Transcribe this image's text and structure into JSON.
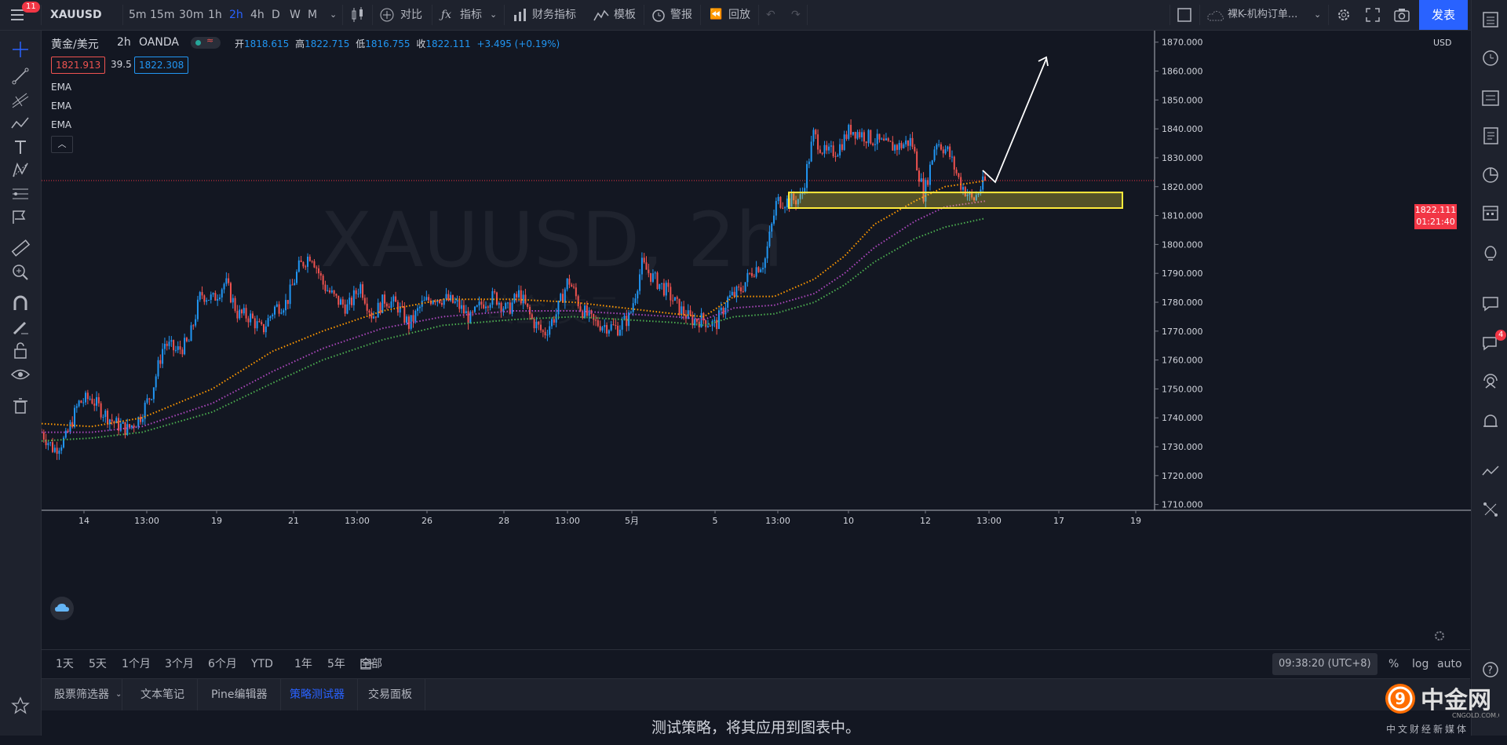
{
  "topbar": {
    "menu_badge": "11",
    "symbol": "XAUUSD",
    "intervals": [
      "5m",
      "15m",
      "30m",
      "1h",
      "2h",
      "4h",
      "D",
      "W",
      "M"
    ],
    "active_interval": "2h",
    "compare": "对比",
    "indicators": "指标",
    "financials": "财务指标",
    "templates": "模板",
    "alert": "警报",
    "replay": "回放",
    "layout_name": "裸K-机构订单...",
    "publish": "发表"
  },
  "legend": {
    "title": "黄金/美元",
    "interval": "2h",
    "source": "OANDA",
    "open_label": "开",
    "open": "1818.615",
    "high_label": "高",
    "high": "1822.715",
    "low_label": "低",
    "low": "1816.755",
    "close_label": "收",
    "close": "1822.111",
    "change": "+3.495 (+0.19%)",
    "bid": "1821.913",
    "spread": "39.5",
    "ask": "1822.308",
    "indicators": [
      "EMA",
      "EMA",
      "EMA"
    ]
  },
  "watermark": {
    "symbol": "XAUUSD, 2h",
    "name": "黄金/美元"
  },
  "price_axis": {
    "currency": "USD",
    "current_price": "1822.111",
    "countdown": "01:21:40"
  },
  "chart_data": {
    "type": "candlestick",
    "y_ticks": [
      "1870.000",
      "1860.000",
      "1850.000",
      "1840.000",
      "1830.000",
      "1820.000",
      "1810.000",
      "1800.000",
      "1790.000",
      "1780.000",
      "1770.000",
      "1760.000",
      "1750.000",
      "1740.000",
      "1730.000",
      "1720.000",
      "1710.000"
    ],
    "x_ticks": [
      "14",
      "13:00",
      "19",
      "21",
      "13:00",
      "26",
      "28",
      "13:00",
      "5月",
      "5",
      "13:00",
      "10",
      "12",
      "13:00",
      "17",
      "19"
    ],
    "ylim": [
      1708,
      1874
    ],
    "current_price": 1822.111,
    "close_path": [
      1735,
      1729,
      1733,
      1745,
      1747,
      1742,
      1738,
      1736,
      1740,
      1749,
      1766,
      1763,
      1766,
      1783,
      1781,
      1787,
      1776,
      1775,
      1770,
      1778,
      1780,
      1792,
      1797,
      1786,
      1781,
      1778,
      1786,
      1775,
      1781,
      1779,
      1772,
      1779,
      1782,
      1781,
      1779,
      1774,
      1780,
      1782,
      1777,
      1783,
      1774,
      1769,
      1776,
      1788,
      1778,
      1773,
      1772,
      1771,
      1775,
      1793,
      1788,
      1784,
      1778,
      1774,
      1774,
      1772,
      1781,
      1784,
      1791,
      1794,
      1815,
      1815,
      1816,
      1838,
      1831,
      1833,
      1840,
      1838,
      1836,
      1834,
      1834,
      1836,
      1817,
      1836,
      1832,
      1821,
      1815,
      1822.1
    ],
    "ema_fast": {
      "color": "#ff9800",
      "values": [
        [
          0,
          1738
        ],
        [
          0.05,
          1737
        ],
        [
          0.1,
          1740
        ],
        [
          0.17,
          1750
        ],
        [
          0.23,
          1763
        ],
        [
          0.28,
          1770
        ],
        [
          0.34,
          1777
        ],
        [
          0.4,
          1781
        ],
        [
          0.47,
          1781
        ],
        [
          0.53,
          1780
        ],
        [
          0.58,
          1778
        ],
        [
          0.63,
          1776
        ],
        [
          0.66,
          1775
        ],
        [
          0.69,
          1782
        ],
        [
          0.73,
          1782
        ],
        [
          0.77,
          1788
        ],
        [
          0.8,
          1796
        ],
        [
          0.83,
          1807
        ],
        [
          0.87,
          1815
        ],
        [
          0.9,
          1820
        ],
        [
          0.94,
          1822
        ]
      ]
    },
    "ema_mid": {
      "color": "#ab47bc",
      "values": [
        [
          0,
          1735
        ],
        [
          0.05,
          1735
        ],
        [
          0.1,
          1737
        ],
        [
          0.17,
          1745
        ],
        [
          0.23,
          1756
        ],
        [
          0.28,
          1764
        ],
        [
          0.34,
          1771
        ],
        [
          0.4,
          1775
        ],
        [
          0.47,
          1777
        ],
        [
          0.53,
          1777
        ],
        [
          0.58,
          1776
        ],
        [
          0.63,
          1775
        ],
        [
          0.66,
          1774
        ],
        [
          0.69,
          1778
        ],
        [
          0.73,
          1779
        ],
        [
          0.77,
          1783
        ],
        [
          0.8,
          1790
        ],
        [
          0.83,
          1799
        ],
        [
          0.87,
          1808
        ],
        [
          0.9,
          1813
        ],
        [
          0.94,
          1815
        ]
      ]
    },
    "ema_slow": {
      "color": "#4caf50",
      "values": [
        [
          0,
          1732
        ],
        [
          0.05,
          1733
        ],
        [
          0.1,
          1735
        ],
        [
          0.17,
          1742
        ],
        [
          0.23,
          1752
        ],
        [
          0.28,
          1760
        ],
        [
          0.34,
          1767
        ],
        [
          0.4,
          1772
        ],
        [
          0.47,
          1774
        ],
        [
          0.53,
          1775
        ],
        [
          0.58,
          1774
        ],
        [
          0.63,
          1773
        ],
        [
          0.66,
          1772
        ],
        [
          0.69,
          1775
        ],
        [
          0.73,
          1776
        ],
        [
          0.77,
          1780
        ],
        [
          0.8,
          1786
        ],
        [
          0.83,
          1794
        ],
        [
          0.87,
          1802
        ],
        [
          0.9,
          1806
        ],
        [
          0.94,
          1809
        ]
      ]
    },
    "zone": {
      "low": 1812.6,
      "high": 1818.0,
      "color": "#ffeb3b"
    },
    "colors": {
      "up": "#2196f3",
      "down": "#ef5350"
    }
  },
  "rangebar": {
    "ranges": [
      "1天",
      "5天",
      "1个月",
      "3个月",
      "6个月",
      "YTD",
      "1年",
      "5年",
      "全部"
    ],
    "time": "09:38:20 (UTC+8)",
    "percent": "%",
    "log": "log",
    "auto": "auto"
  },
  "tabs": [
    "股票筛选器",
    "文本笔记",
    "Pine编辑器",
    "策略测试器",
    "交易面板"
  ],
  "active_tab": "策略测试器",
  "panel_message": "测试策略，将其应用到图表中。",
  "right_badge": "4",
  "logo": {
    "name": "中金网",
    "domain": "CNGOLD.COM.CN",
    "slogan": "中文财经新媒体"
  }
}
